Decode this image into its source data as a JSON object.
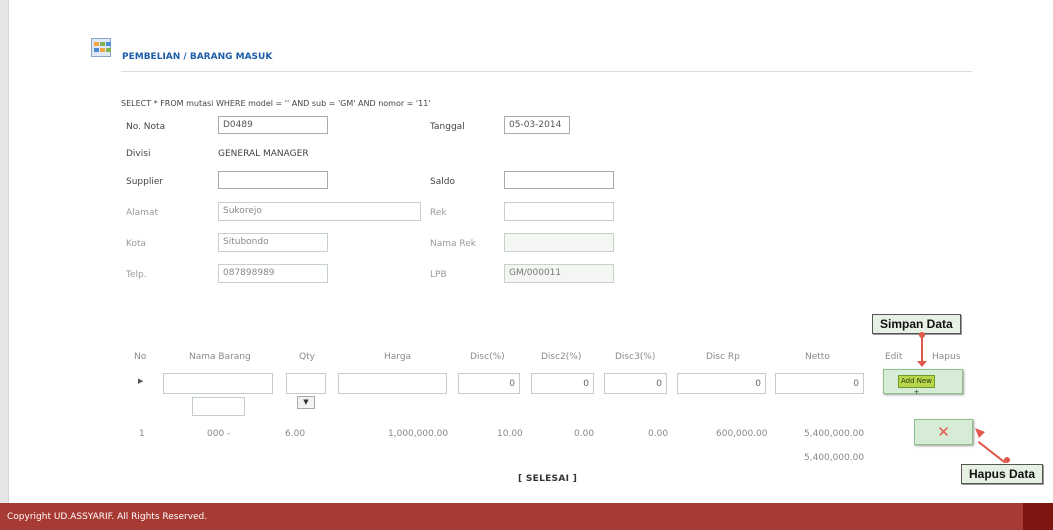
{
  "header": {
    "title": "PEMBELIAN / BARANG MASUK",
    "sql": "SELECT * FROM mutasi WHERE model = '' AND sub = 'GM' AND nomor = '11'"
  },
  "form": {
    "no_nota_label": "No. Nota",
    "no_nota_value": "D0489",
    "tanggal_label": "Tanggal",
    "tanggal_value": "05-03-2014",
    "divisi_label": "Divisi",
    "divisi_value": "GENERAL MANAGER",
    "supplier_label": "Supplier",
    "supplier_value": "",
    "saldo_label": "Saldo",
    "saldo_value": "",
    "alamat_label": "Alamat",
    "alamat_value": "Sukorejo",
    "rek_label": "Rek",
    "rek_value": "",
    "kota_label": "Kota",
    "kota_value": "Situbondo",
    "nama_rek_label": "Nama Rek",
    "nama_rek_value": "",
    "telp_label": "Telp.",
    "telp_value": "087898989",
    "lpb_label": "LPB",
    "lpb_value": "GM/000011"
  },
  "table": {
    "headers": {
      "no": "No",
      "nama_barang": "Nama Barang",
      "qty": "Qty",
      "harga": "Harga",
      "disc1": "Disc(%)",
      "disc2": "Disc2(%)",
      "disc3": "Disc3(%)",
      "disc_rp": "Disc Rp",
      "netto": "Netto",
      "edit": "Edit",
      "hapus": "Hapus"
    },
    "input_row": {
      "disc1": "0",
      "disc2": "0",
      "disc3": "0",
      "disc_rp": "0",
      "netto": "0",
      "add_new_label": "Add New +"
    },
    "data_row": {
      "no": "1",
      "nama_barang": "000 -",
      "qty": "6.00",
      "harga": "1,000,000.00",
      "disc1": "10.00",
      "disc2": "0.00",
      "disc3": "0.00",
      "disc_rp": "600,000.00",
      "netto": "5,400,000.00"
    },
    "total": "5,400,000.00",
    "selesai_label": "[ SELESAI ]",
    "delete_symbol": "✕"
  },
  "callouts": {
    "simpan": "Simpan Data",
    "hapus": "Hapus Data"
  },
  "footer": {
    "copyright": "Copyright UD.ASSYARIF. All Rights Reserved."
  },
  "colors": {
    "accent": "#1e5ca8",
    "footer": "#a83a34",
    "button_green": "#d6ecd6",
    "callout_arrow": "#e0584a"
  }
}
